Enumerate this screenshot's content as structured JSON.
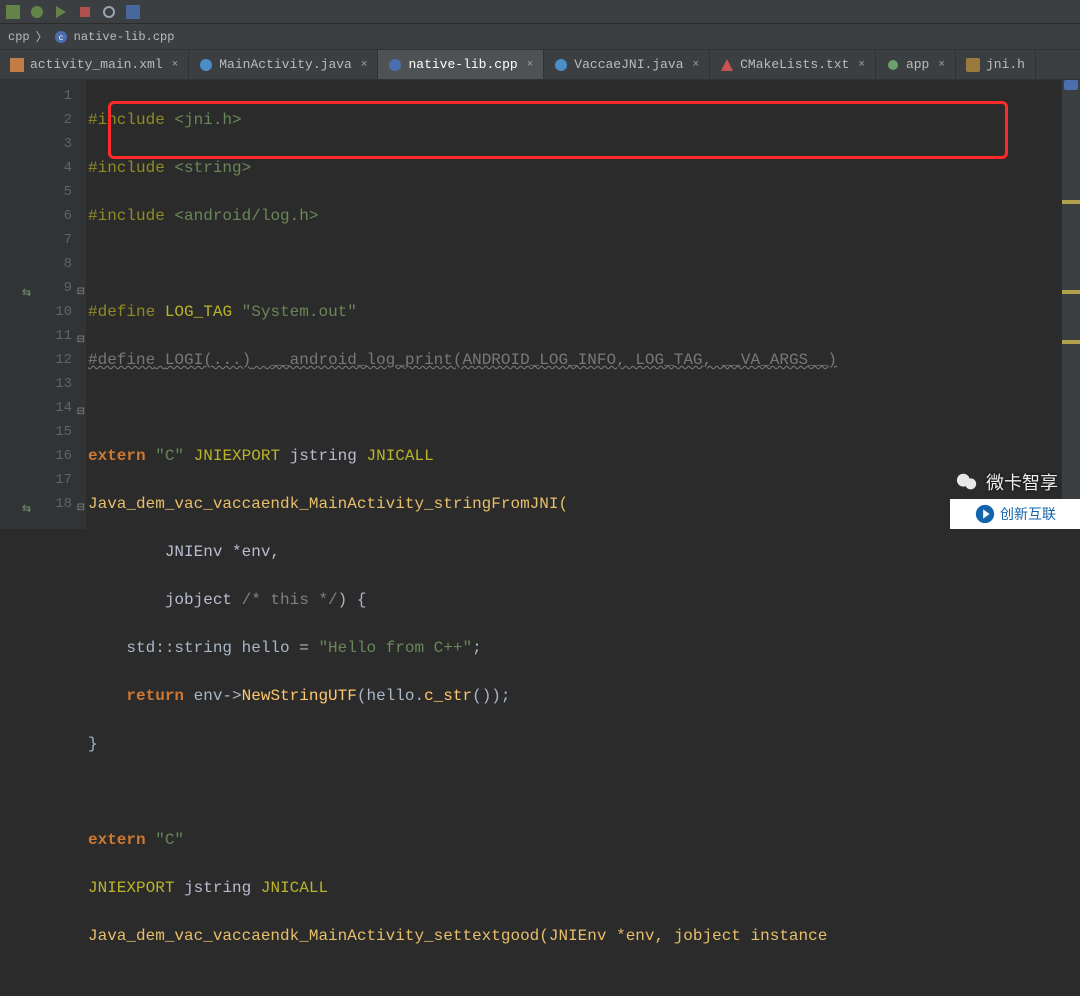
{
  "breadcrumb": {
    "item1": "cpp",
    "item2": "native-lib.cpp",
    "sep": "〉"
  },
  "tabs": {
    "t1": "activity_main.xml",
    "t2": "MainActivity.java",
    "t3": "native-lib.cpp",
    "t4": "VaccaeJNI.java",
    "t5": "CMakeLists.txt",
    "t6": "app",
    "t7": "jni.h"
  },
  "lines": {
    "l1": "#include <jni.h>",
    "l2": "#include <string>",
    "l3": "#include <android/log.h>",
    "l4": "",
    "l5a": "#define",
    "l5b": "LOG_TAG",
    "l5c": "\"System.out\"",
    "l6a": "#define",
    "l6b": "LOGI(...)",
    "l6c": "__android_log_print(ANDROID_LOG_INFO, LOG_TAG, __VA_ARGS__)",
    "l7": "",
    "l8a": "extern",
    "l8b": "\"C\"",
    "l8c": "JNIEXPORT",
    "l8d": "jstring",
    "l8e": "JNICALL",
    "l9": "Java_dem_vac_vaccaendk_MainActivity_stringFromJNI(",
    "l10a": "JNIEnv *env,",
    "l11a": "jobject",
    "l11b": "/* this */",
    "l11c": ") {",
    "l12a": "std::string hello = ",
    "l12b": "\"Hello from C++\"",
    "l12c": ";",
    "l13a": "return",
    "l13b": "env->",
    "l13c": "NewStringUTF",
    "l13d": "(hello.",
    "l13e": "c_str",
    "l13f": "());",
    "l14": "}",
    "l15": "",
    "l16a": "extern",
    "l16b": "\"C\"",
    "l17a": "JNIEXPORT",
    "l17b": "jstring",
    "l17c": "JNICALL",
    "l18": "Java_dem_vac_vaccaendk_MainActivity_settextgood(JNIEnv *env, jobject instance"
  },
  "watermark": {
    "wx": "微卡智享",
    "cx": "创新互联"
  }
}
